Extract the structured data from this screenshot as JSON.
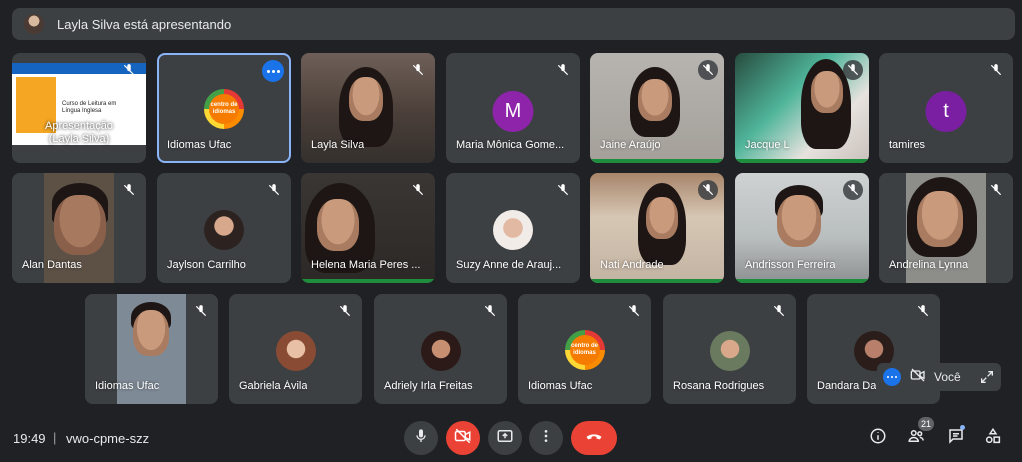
{
  "presenting_bar": {
    "label": "Layla Silva está apresentando"
  },
  "tiles_row1": [
    {
      "name": "Apresentação\n(Layla Silva)",
      "kind": "slide",
      "slide_title": "Curso de Leitura em Língua Inglesa",
      "slide_header": "centro de idiomas"
    },
    {
      "name": "Idiomas Ufac",
      "kind": "logo",
      "logo_text": [
        "centro de",
        "idiomas"
      ]
    },
    {
      "name": "Layla Silva",
      "kind": "video"
    },
    {
      "name": "Maria Mônica Gome...",
      "kind": "letter",
      "letter": "M",
      "color": "#8e24aa"
    },
    {
      "name": "Jaine Araújo",
      "kind": "video"
    },
    {
      "name": "Jacque L",
      "kind": "video"
    },
    {
      "name": "tamires",
      "kind": "letter",
      "letter": "t",
      "color": "#7b1fa2"
    }
  ],
  "tiles_row2": [
    {
      "name": "Alan Dantas"
    },
    {
      "name": "Jaylson Carrilho"
    },
    {
      "name": "Helena Maria Peres ..."
    },
    {
      "name": "Suzy Anne de Arauj..."
    },
    {
      "name": "Nati Andrade"
    },
    {
      "name": "Andrisson Ferreira"
    },
    {
      "name": "Andrelina Lynna"
    }
  ],
  "tiles_row3": [
    {
      "name": "Idiomas Ufac"
    },
    {
      "name": "Gabriela Ávila"
    },
    {
      "name": "Adriely Irla Freitas"
    },
    {
      "name": "Idiomas Ufac",
      "logo_text": [
        "centro de",
        "idiomas"
      ]
    },
    {
      "name": "Rosana Rodrigues"
    },
    {
      "name": "Dandara Da"
    }
  ],
  "self_view": {
    "label": "Você"
  },
  "bottom_bar": {
    "time": "19:49",
    "separator": "|",
    "meeting_code": "vwo-cpme-szz",
    "participant_count": "21"
  },
  "colors": {
    "background": "#202124",
    "tile": "#3c4043",
    "accent": "#1a73e8",
    "danger": "#ea4335",
    "speaking": "#1e8e3e"
  }
}
